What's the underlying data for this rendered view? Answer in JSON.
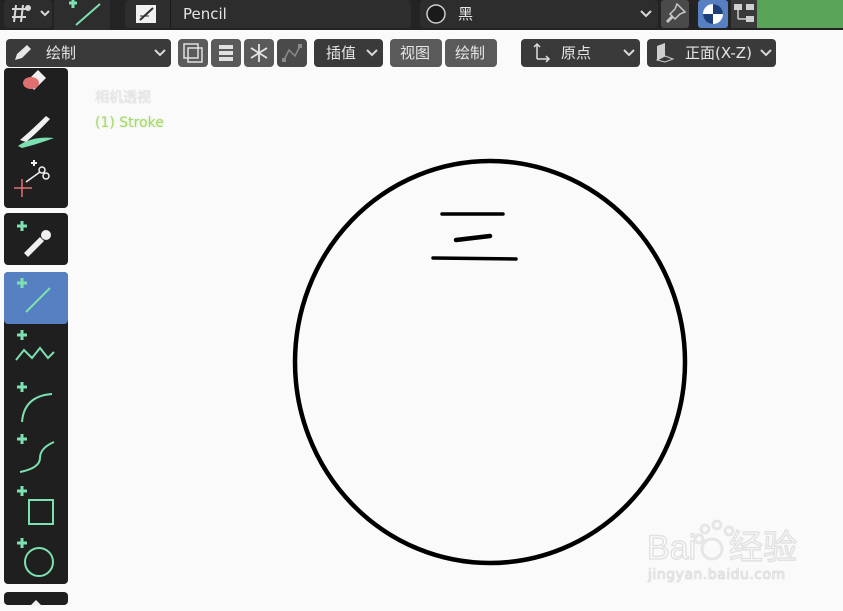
{
  "top": {
    "object_name": "Pencil",
    "material_name": "黑"
  },
  "toolbar": {
    "mode": "绘制",
    "interp": "插值",
    "view": "视图",
    "draw": "绘制",
    "pivot": "原点",
    "orientation": "正面(X-Z)"
  },
  "viewport": {
    "view_name": "相机透视",
    "object_label": "(1) Stroke"
  },
  "tools": {
    "active": "line-tool"
  },
  "watermark": {
    "site": "jingyan.baidu.com"
  },
  "colors": {
    "accent": "#5680c2",
    "add_icon": "#7de0b0",
    "object_label": "#a6d86e",
    "status_green": "#5aa45a"
  }
}
